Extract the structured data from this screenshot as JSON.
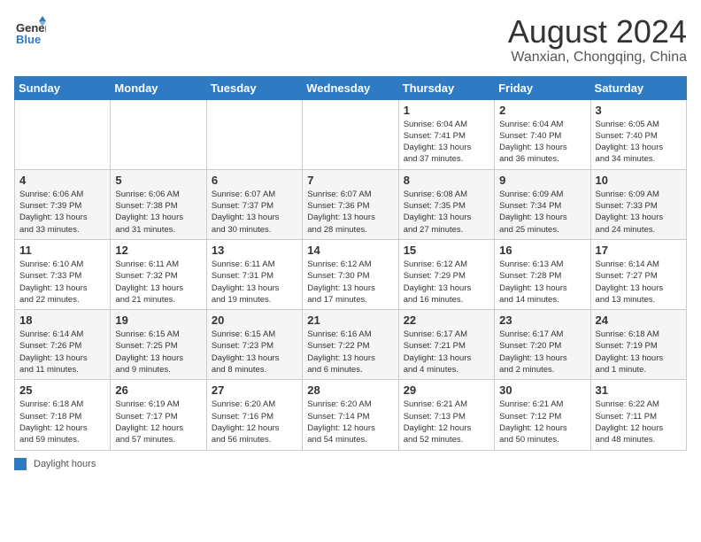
{
  "logo": {
    "general": "General",
    "blue": "Blue"
  },
  "title": "August 2024",
  "subtitle": "Wanxian, Chongqing, China",
  "days_of_week": [
    "Sunday",
    "Monday",
    "Tuesday",
    "Wednesday",
    "Thursday",
    "Friday",
    "Saturday"
  ],
  "weeks": [
    [
      {
        "day": "",
        "info": ""
      },
      {
        "day": "",
        "info": ""
      },
      {
        "day": "",
        "info": ""
      },
      {
        "day": "",
        "info": ""
      },
      {
        "day": "1",
        "info": "Sunrise: 6:04 AM\nSunset: 7:41 PM\nDaylight: 13 hours\nand 37 minutes."
      },
      {
        "day": "2",
        "info": "Sunrise: 6:04 AM\nSunset: 7:40 PM\nDaylight: 13 hours\nand 36 minutes."
      },
      {
        "day": "3",
        "info": "Sunrise: 6:05 AM\nSunset: 7:40 PM\nDaylight: 13 hours\nand 34 minutes."
      }
    ],
    [
      {
        "day": "4",
        "info": "Sunrise: 6:06 AM\nSunset: 7:39 PM\nDaylight: 13 hours\nand 33 minutes."
      },
      {
        "day": "5",
        "info": "Sunrise: 6:06 AM\nSunset: 7:38 PM\nDaylight: 13 hours\nand 31 minutes."
      },
      {
        "day": "6",
        "info": "Sunrise: 6:07 AM\nSunset: 7:37 PM\nDaylight: 13 hours\nand 30 minutes."
      },
      {
        "day": "7",
        "info": "Sunrise: 6:07 AM\nSunset: 7:36 PM\nDaylight: 13 hours\nand 28 minutes."
      },
      {
        "day": "8",
        "info": "Sunrise: 6:08 AM\nSunset: 7:35 PM\nDaylight: 13 hours\nand 27 minutes."
      },
      {
        "day": "9",
        "info": "Sunrise: 6:09 AM\nSunset: 7:34 PM\nDaylight: 13 hours\nand 25 minutes."
      },
      {
        "day": "10",
        "info": "Sunrise: 6:09 AM\nSunset: 7:33 PM\nDaylight: 13 hours\nand 24 minutes."
      }
    ],
    [
      {
        "day": "11",
        "info": "Sunrise: 6:10 AM\nSunset: 7:33 PM\nDaylight: 13 hours\nand 22 minutes."
      },
      {
        "day": "12",
        "info": "Sunrise: 6:11 AM\nSunset: 7:32 PM\nDaylight: 13 hours\nand 21 minutes."
      },
      {
        "day": "13",
        "info": "Sunrise: 6:11 AM\nSunset: 7:31 PM\nDaylight: 13 hours\nand 19 minutes."
      },
      {
        "day": "14",
        "info": "Sunrise: 6:12 AM\nSunset: 7:30 PM\nDaylight: 13 hours\nand 17 minutes."
      },
      {
        "day": "15",
        "info": "Sunrise: 6:12 AM\nSunset: 7:29 PM\nDaylight: 13 hours\nand 16 minutes."
      },
      {
        "day": "16",
        "info": "Sunrise: 6:13 AM\nSunset: 7:28 PM\nDaylight: 13 hours\nand 14 minutes."
      },
      {
        "day": "17",
        "info": "Sunrise: 6:14 AM\nSunset: 7:27 PM\nDaylight: 13 hours\nand 13 minutes."
      }
    ],
    [
      {
        "day": "18",
        "info": "Sunrise: 6:14 AM\nSunset: 7:26 PM\nDaylight: 13 hours\nand 11 minutes."
      },
      {
        "day": "19",
        "info": "Sunrise: 6:15 AM\nSunset: 7:25 PM\nDaylight: 13 hours\nand 9 minutes."
      },
      {
        "day": "20",
        "info": "Sunrise: 6:15 AM\nSunset: 7:23 PM\nDaylight: 13 hours\nand 8 minutes."
      },
      {
        "day": "21",
        "info": "Sunrise: 6:16 AM\nSunset: 7:22 PM\nDaylight: 13 hours\nand 6 minutes."
      },
      {
        "day": "22",
        "info": "Sunrise: 6:17 AM\nSunset: 7:21 PM\nDaylight: 13 hours\nand 4 minutes."
      },
      {
        "day": "23",
        "info": "Sunrise: 6:17 AM\nSunset: 7:20 PM\nDaylight: 13 hours\nand 2 minutes."
      },
      {
        "day": "24",
        "info": "Sunrise: 6:18 AM\nSunset: 7:19 PM\nDaylight: 13 hours\nand 1 minute."
      }
    ],
    [
      {
        "day": "25",
        "info": "Sunrise: 6:18 AM\nSunset: 7:18 PM\nDaylight: 12 hours\nand 59 minutes."
      },
      {
        "day": "26",
        "info": "Sunrise: 6:19 AM\nSunset: 7:17 PM\nDaylight: 12 hours\nand 57 minutes."
      },
      {
        "day": "27",
        "info": "Sunrise: 6:20 AM\nSunset: 7:16 PM\nDaylight: 12 hours\nand 56 minutes."
      },
      {
        "day": "28",
        "info": "Sunrise: 6:20 AM\nSunset: 7:14 PM\nDaylight: 12 hours\nand 54 minutes."
      },
      {
        "day": "29",
        "info": "Sunrise: 6:21 AM\nSunset: 7:13 PM\nDaylight: 12 hours\nand 52 minutes."
      },
      {
        "day": "30",
        "info": "Sunrise: 6:21 AM\nSunset: 7:12 PM\nDaylight: 12 hours\nand 50 minutes."
      },
      {
        "day": "31",
        "info": "Sunrise: 6:22 AM\nSunset: 7:11 PM\nDaylight: 12 hours\nand 48 minutes."
      }
    ]
  ],
  "footer": {
    "label": "Daylight hours"
  }
}
